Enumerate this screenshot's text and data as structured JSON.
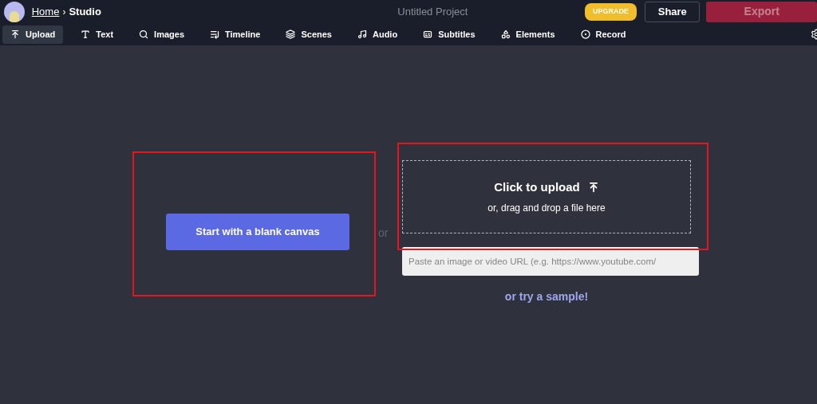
{
  "breadcrumb": {
    "home": "Home",
    "separator": "›",
    "current": "Studio"
  },
  "project_title": "Untitled Project",
  "header_buttons": {
    "upgrade": "UPGRADE",
    "share": "Share",
    "export": "Export"
  },
  "tabs": [
    {
      "label": "Upload",
      "selected": true
    },
    {
      "label": "Text",
      "selected": false
    },
    {
      "label": "Images",
      "selected": false
    },
    {
      "label": "Timeline",
      "selected": false
    },
    {
      "label": "Scenes",
      "selected": false
    },
    {
      "label": "Audio",
      "selected": false
    },
    {
      "label": "Subtitles",
      "selected": false
    },
    {
      "label": "Elements",
      "selected": false
    },
    {
      "label": "Record",
      "selected": false
    }
  ],
  "blank_canvas_button": "Start with a blank canvas",
  "separator_text": "or",
  "dropzone": {
    "title": "Click to upload",
    "subtitle": "or, drag and drop a file here"
  },
  "url_field": {
    "placeholder": "Paste an image or video URL (e.g. https://www.youtube.com/"
  },
  "sample_link": "or try a sample!"
}
